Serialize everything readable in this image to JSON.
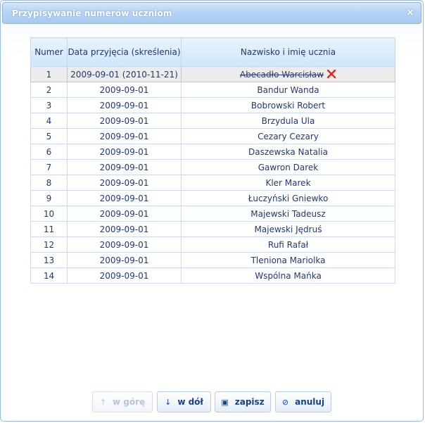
{
  "dialog": {
    "title": "Przypisywanie numerów uczniom",
    "close_glyph": "×"
  },
  "table": {
    "headers": [
      "Numer",
      "Data przyjęcia (skreślenia)",
      "Nazwisko i imię ucznia"
    ],
    "rows": [
      {
        "num": "1",
        "date": "2009-09-01 (2010-11-21)",
        "name": "Abecadło Warcisław",
        "struck": true
      },
      {
        "num": "2",
        "date": "2009-09-01",
        "name": "Bandur Wanda"
      },
      {
        "num": "3",
        "date": "2009-09-01",
        "name": "Bobrowski Robert"
      },
      {
        "num": "4",
        "date": "2009-09-01",
        "name": "Brzydula Ula"
      },
      {
        "num": "5",
        "date": "2009-09-01",
        "name": "Cezary Cezary"
      },
      {
        "num": "6",
        "date": "2009-09-01",
        "name": "Daszewska Natalia"
      },
      {
        "num": "7",
        "date": "2009-09-01",
        "name": "Gawron Darek"
      },
      {
        "num": "8",
        "date": "2009-09-01",
        "name": "Kler Marek"
      },
      {
        "num": "9",
        "date": "2009-09-01",
        "name": "Łuczyński Gniewko"
      },
      {
        "num": "10",
        "date": "2009-09-01",
        "name": "Majewski Tadeusz"
      },
      {
        "num": "11",
        "date": "2009-09-01",
        "name": "Majewski Jędruś"
      },
      {
        "num": "12",
        "date": "2009-09-01",
        "name": "Rufi Rafał"
      },
      {
        "num": "13",
        "date": "2009-09-01",
        "name": "Tleniona Mariolka"
      },
      {
        "num": "14",
        "date": "2009-09-01",
        "name": "Wspólna Mańka"
      }
    ]
  },
  "buttons": {
    "up": {
      "label": "w górę",
      "icon": "arrow-up-icon",
      "glyph": "↑",
      "enabled": false
    },
    "down": {
      "label": "w dół",
      "icon": "arrow-down-icon",
      "glyph": "↓",
      "enabled": true
    },
    "save": {
      "label": "zapisz",
      "icon": "save-icon",
      "glyph": "▣",
      "enabled": true
    },
    "cancel": {
      "label": "anuluj",
      "icon": "cancel-icon",
      "glyph": "⊘",
      "enabled": true
    }
  },
  "colors": {
    "title_bar": "#b6d4f6",
    "accent_text": "#15428b",
    "remove_icon": "#e0281e"
  }
}
